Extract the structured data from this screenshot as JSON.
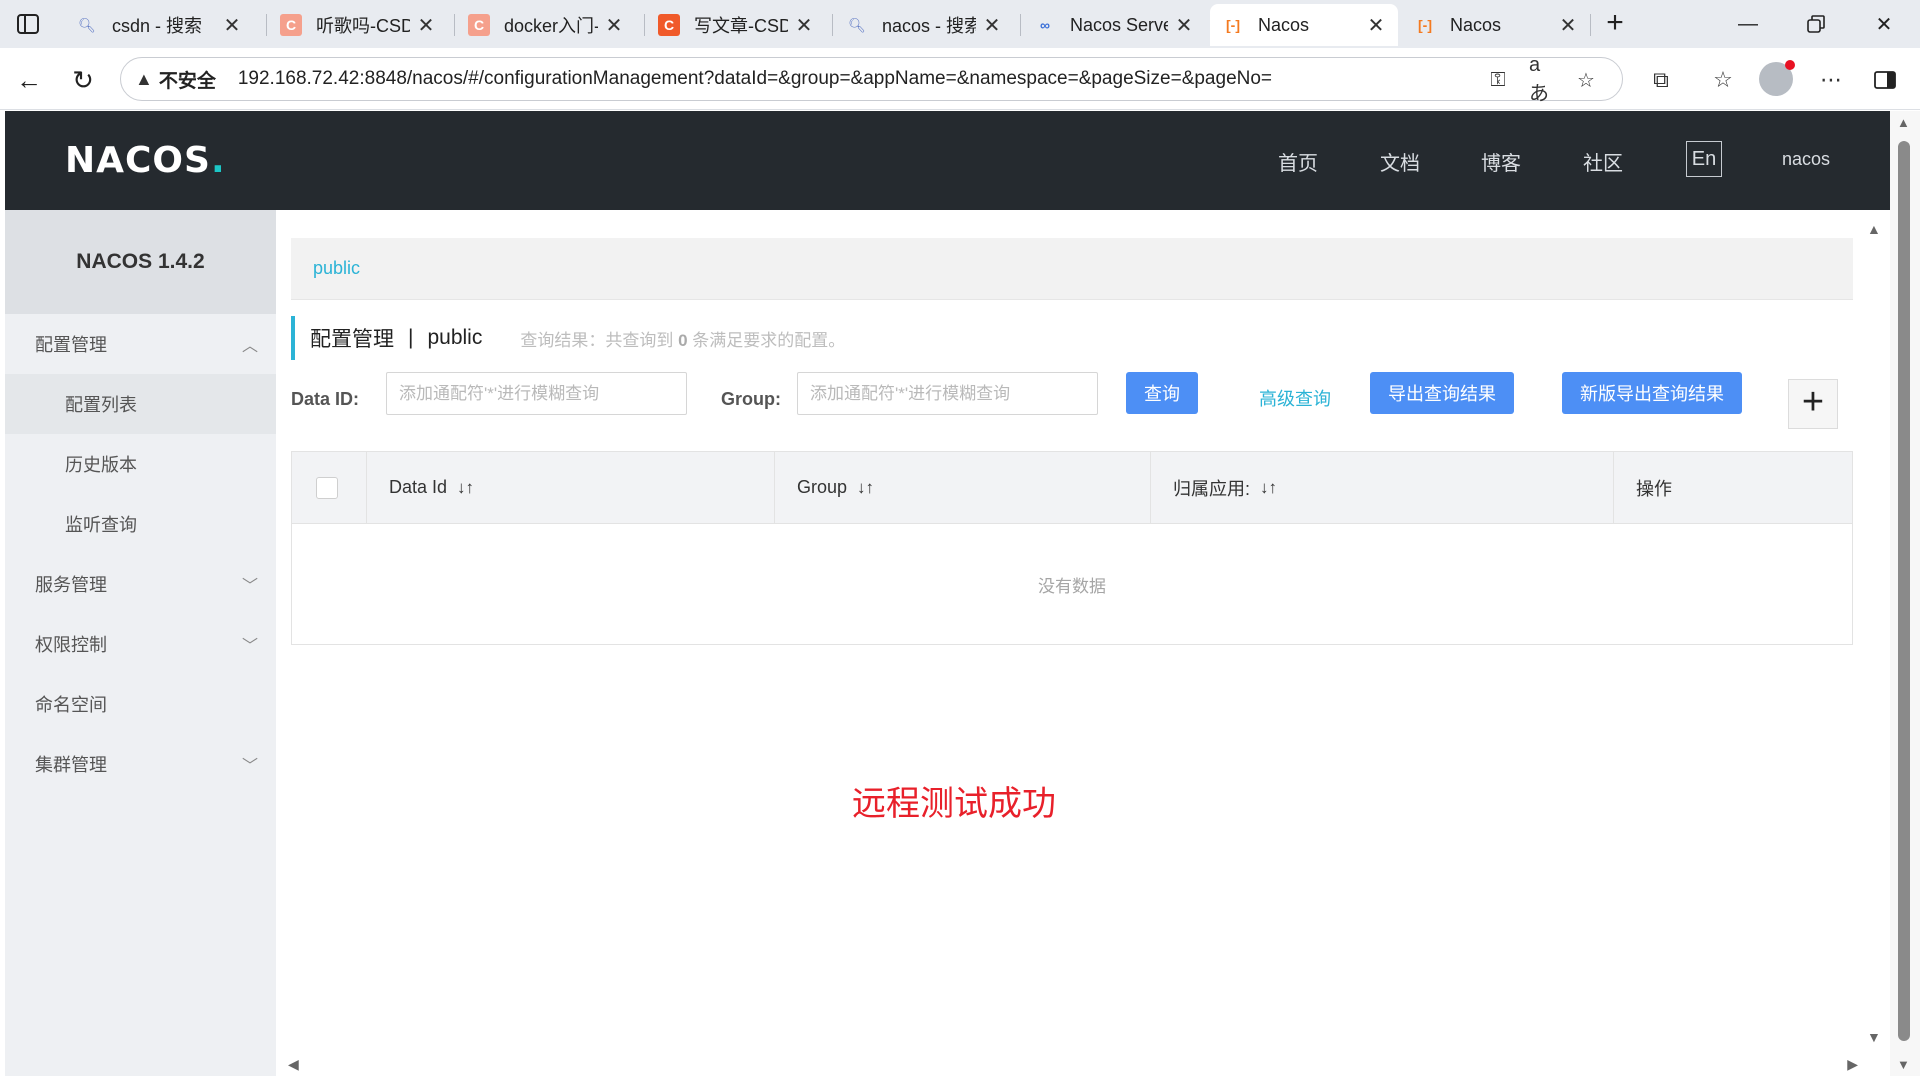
{
  "browser": {
    "tabs": [
      {
        "label": "csdn - 搜索",
        "icon": "search-icon"
      },
      {
        "label": "听歌吗-CSDN",
        "icon": "csdn-icon"
      },
      {
        "label": "docker入门-",
        "icon": "csdn-icon"
      },
      {
        "label": "写文章-CSDN",
        "icon": "csdn-icon"
      },
      {
        "label": "nacos - 搜索",
        "icon": "search-icon"
      },
      {
        "label": "Nacos Server",
        "icon": "link-icon"
      },
      {
        "label": "Nacos",
        "icon": "nacos-icon"
      },
      {
        "label": "Nacos",
        "icon": "nacos-icon"
      }
    ],
    "security_label": "不安全",
    "url": "192.168.72.42:8848/nacos/#/configurationManagement?dataId=&group=&appName=&namespace=&pageSize=&pageNo="
  },
  "header": {
    "logo": "NACOS",
    "nav": [
      "首页",
      "文档",
      "博客",
      "社区"
    ],
    "lang": "En",
    "user": "nacos"
  },
  "sidebar": {
    "title": "NACOS 1.4.2",
    "config_group": "配置管理",
    "config_items": [
      "配置列表",
      "历史版本",
      "监听查询"
    ],
    "items": [
      "服务管理",
      "权限控制",
      "命名空间",
      "集群管理"
    ]
  },
  "main": {
    "namespace_tab": "public",
    "title": "配置管理",
    "title_separator": "|",
    "namespace": "public",
    "result_prefix": "查询结果：共查询到",
    "result_count": "0",
    "result_suffix": "条满足要求的配置。",
    "filters": {
      "data_id_label": "Data ID:",
      "data_id_placeholder": "添加通配符'*'进行模糊查询",
      "group_label": "Group:",
      "group_placeholder": "添加通配符'*'进行模糊查询"
    },
    "buttons": {
      "query": "查询",
      "advanced": "高级查询",
      "export": "导出查询结果",
      "new_export": "新版导出查询结果"
    },
    "table": {
      "columns": [
        "Data Id",
        "Group",
        "归属应用:",
        "操作"
      ],
      "empty": "没有数据"
    },
    "note": "远程测试成功"
  }
}
